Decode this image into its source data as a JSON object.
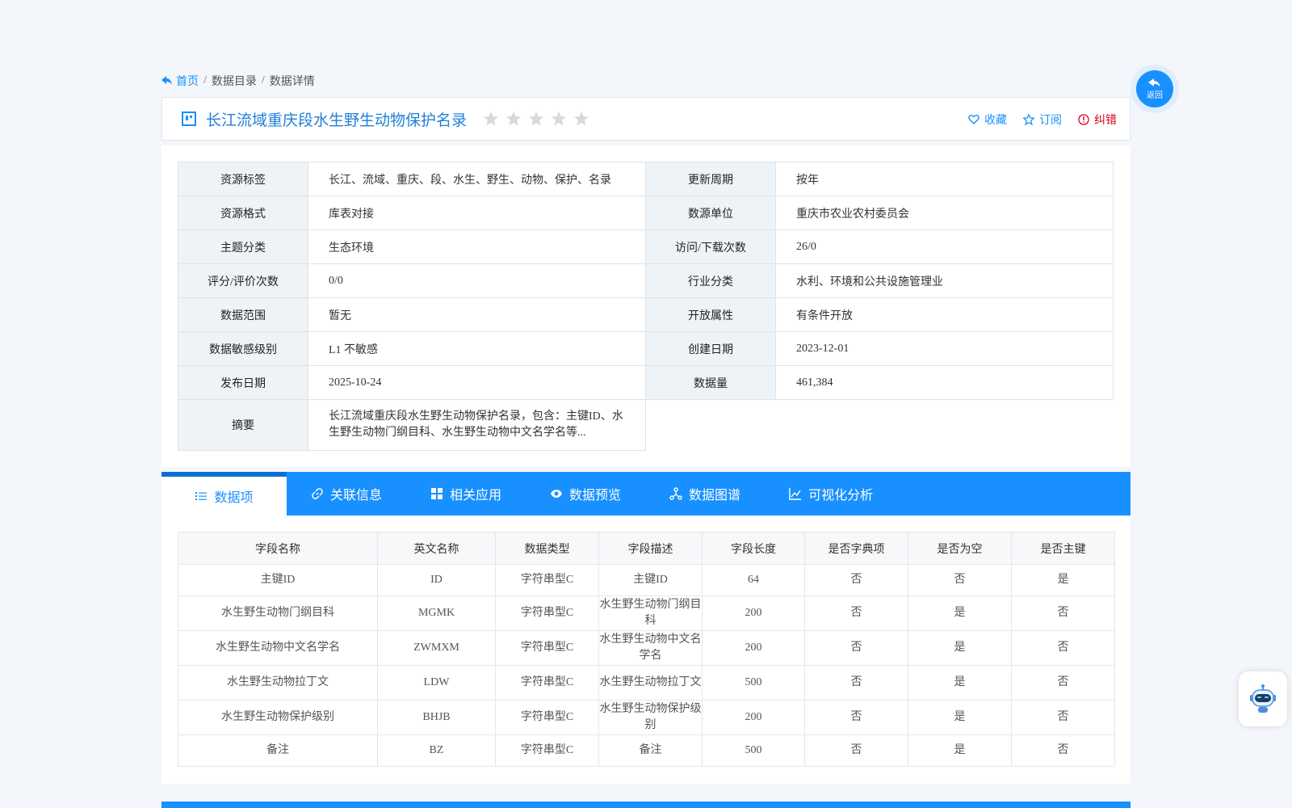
{
  "breadcrumb": {
    "home": "首页",
    "sep1": "/",
    "crumb1": "数据目录",
    "sep2": "/",
    "crumb2": "数据详情"
  },
  "title": "长江流域重庆段水生野生动物保护名录",
  "rating_stars": 0,
  "actions": {
    "favorite": "收藏",
    "subscribe": "订阅",
    "report": "纠错"
  },
  "info": [
    {
      "k1": "资源标签",
      "v1": "长江、流域、重庆、段、水生、野生、动物、保护、名录",
      "k2": "更新周期",
      "v2": "按年"
    },
    {
      "k1": "资源格式",
      "v1": "库表对接",
      "k2": "数源单位",
      "v2": "重庆市农业农村委员会"
    },
    {
      "k1": "主题分类",
      "v1": "生态环境",
      "k2": "访问/下载次数",
      "v2": "26/0"
    },
    {
      "k1": "评分/评价次数",
      "v1": "0/0",
      "k2": "行业分类",
      "v2": "水利、环境和公共设施管理业"
    },
    {
      "k1": "数据范围",
      "v1": "暂无",
      "k2": "开放属性",
      "v2": "有条件开放"
    },
    {
      "k1": "数据敏感级别",
      "v1": "L1 不敏感",
      "k2": "创建日期",
      "v2": "2023-12-01"
    },
    {
      "k1": "发布日期",
      "v1": "2025-10-24",
      "k2": "数据量",
      "v2": "461,384"
    }
  ],
  "abstract": {
    "label": "摘要",
    "text": "长江流域重庆段水生野生动物保护名录，包含：主键ID、水生野生动物门纲目科、水生野生动物中文名学名等..."
  },
  "tabs": [
    "数据项",
    "关联信息",
    "相关应用",
    "数据预览",
    "数据图谱",
    "可视化分析"
  ],
  "fields": {
    "headers": [
      "字段名称",
      "英文名称",
      "数据类型",
      "字段描述",
      "字段长度",
      "是否字典项",
      "是否为空",
      "是否主键"
    ],
    "rows": [
      [
        "主键ID",
        "ID",
        "字符串型C",
        "主键ID",
        "64",
        "否",
        "否",
        "是"
      ],
      [
        "水生野生动物门纲目科",
        "MGMK",
        "字符串型C",
        "水生野生动物门纲目科",
        "200",
        "否",
        "是",
        "否"
      ],
      [
        "水生野生动物中文名学名",
        "ZWMXM",
        "字符串型C",
        "水生野生动物中文名学名",
        "200",
        "否",
        "是",
        "否"
      ],
      [
        "水生野生动物拉丁文",
        "LDW",
        "字符串型C",
        "水生野生动物拉丁文",
        "500",
        "否",
        "是",
        "否"
      ],
      [
        "水生野生动物保护级别",
        "BHJB",
        "字符串型C",
        "水生野生动物保护级别",
        "200",
        "否",
        "是",
        "否"
      ],
      [
        "备注",
        "BZ",
        "字符串型C",
        "备注",
        "500",
        "否",
        "是",
        "否"
      ]
    ]
  },
  "back_label": "返回",
  "colors": {
    "primary": "#1890ff",
    "error": "#d9001b",
    "label_bg": "#eef3f8"
  }
}
